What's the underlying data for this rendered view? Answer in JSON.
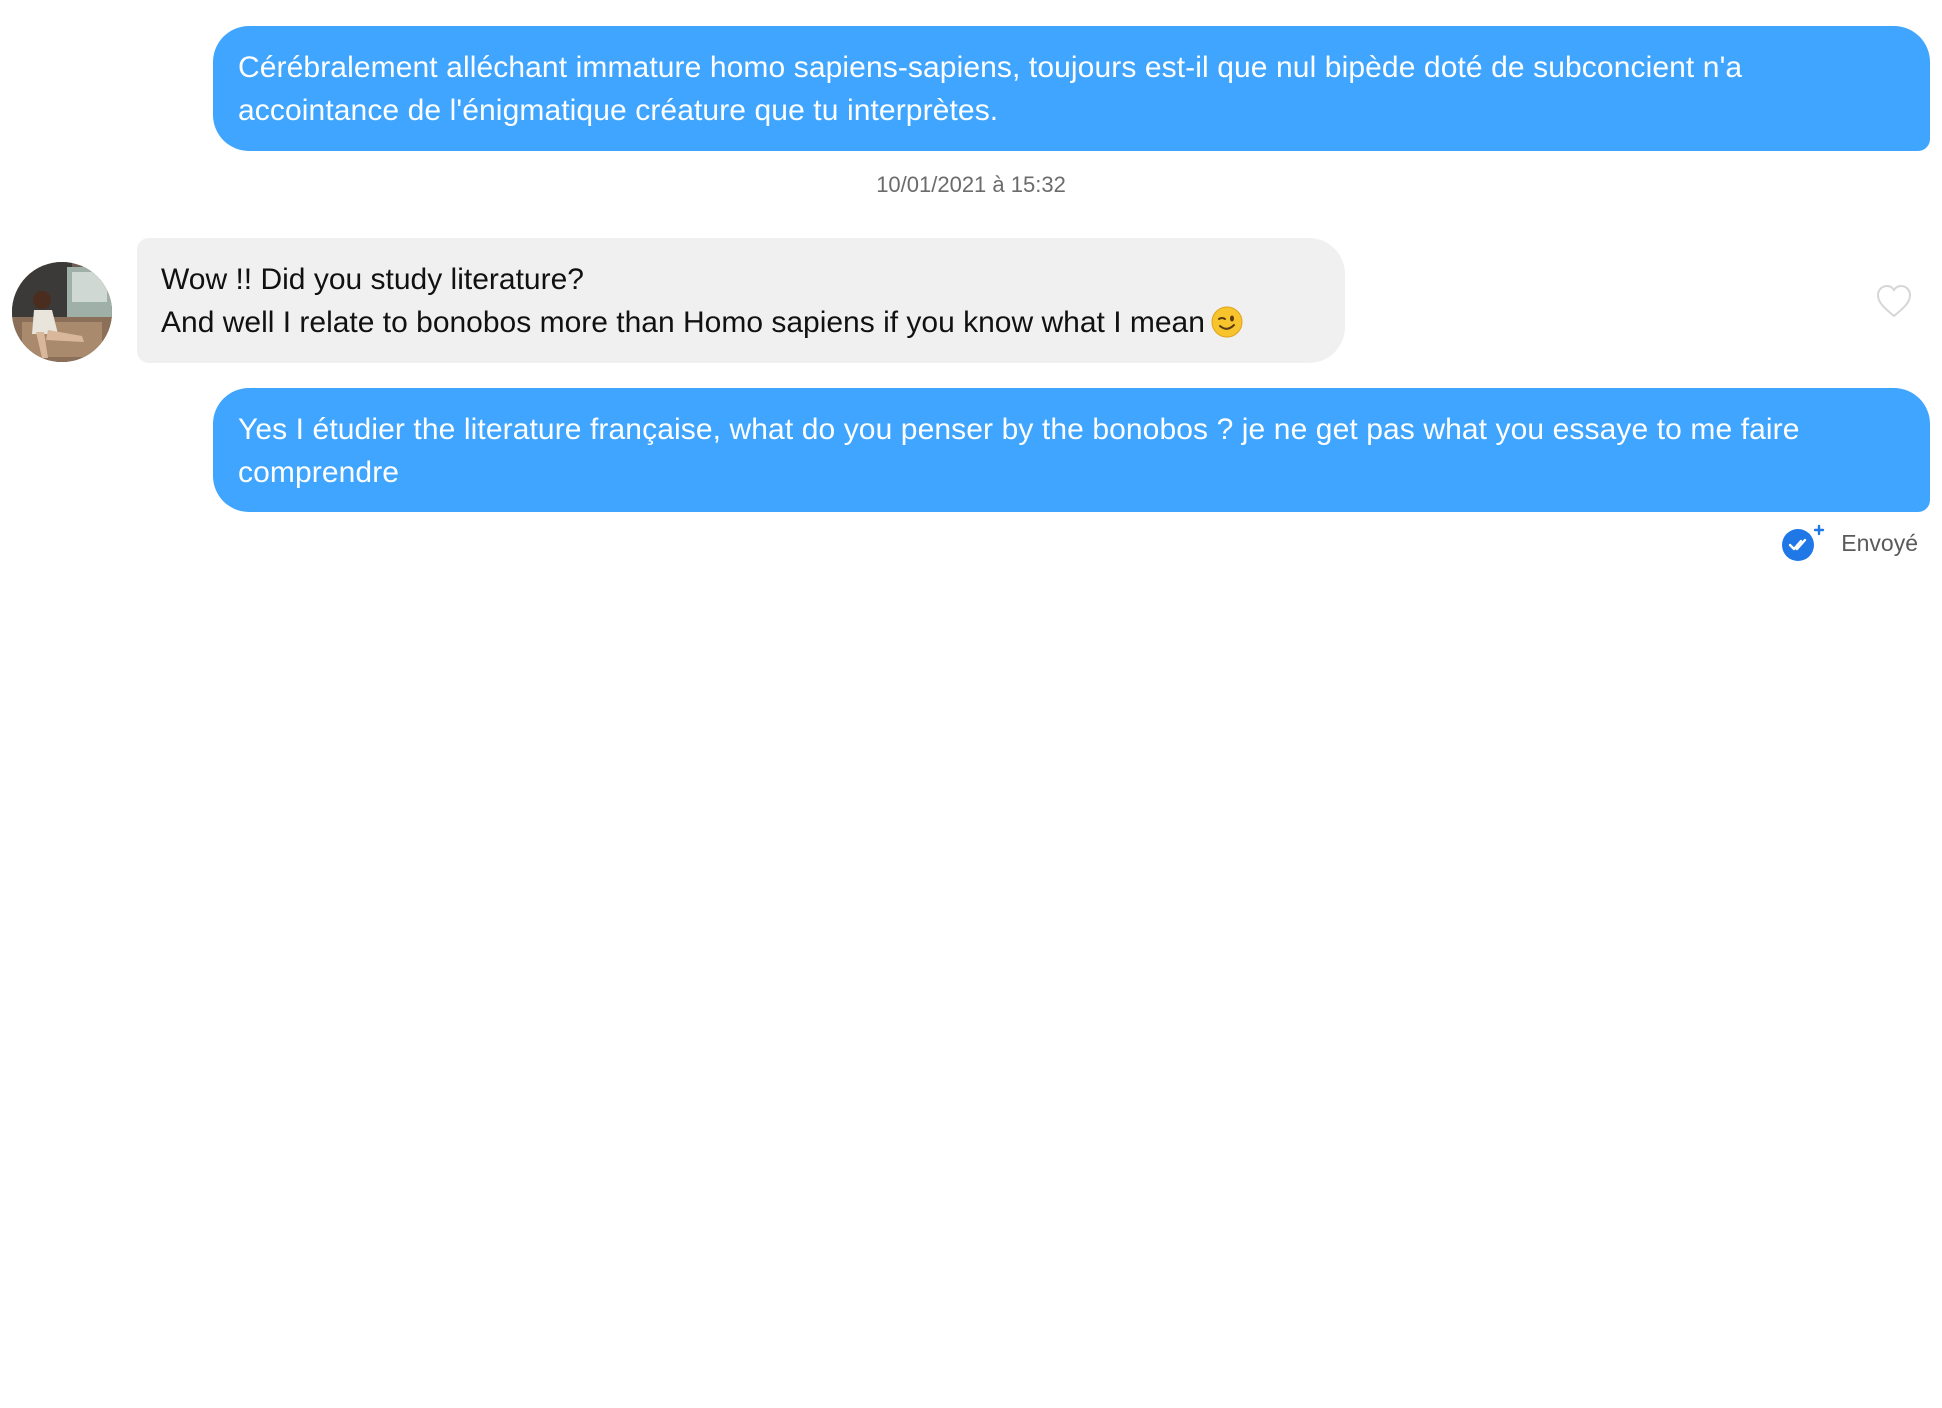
{
  "messages": {
    "outgoing_1": {
      "text": "Cérébralement alléchant immature homo sapiens-sapiens, toujours est-il que nul bipède doté de subconcient n'a accointance de l'énigmatique créature que tu interprètes."
    },
    "timestamp": "10/01/2021 à 15:32",
    "incoming_1": {
      "line1": "Wow !! Did you study literature?",
      "line2": "And well I relate to bonobos more than Homo sapiens if you know what I mean",
      "emoji": "winking-face-emoji"
    },
    "outgoing_2": {
      "text": "Yes I étudier the literature française, what do you penser by the bonobos ? je ne get pas what you essaye to me faire comprendre"
    },
    "status": {
      "label": "Envoyé",
      "icon": "double-check-icon"
    }
  },
  "colors": {
    "outgoing_bubble": "#3fa5ff",
    "incoming_bubble": "#f0f0f0",
    "status_icon": "#1f78e6"
  },
  "icons": {
    "like": "heart-outline-icon",
    "avatar": "user-avatar"
  }
}
